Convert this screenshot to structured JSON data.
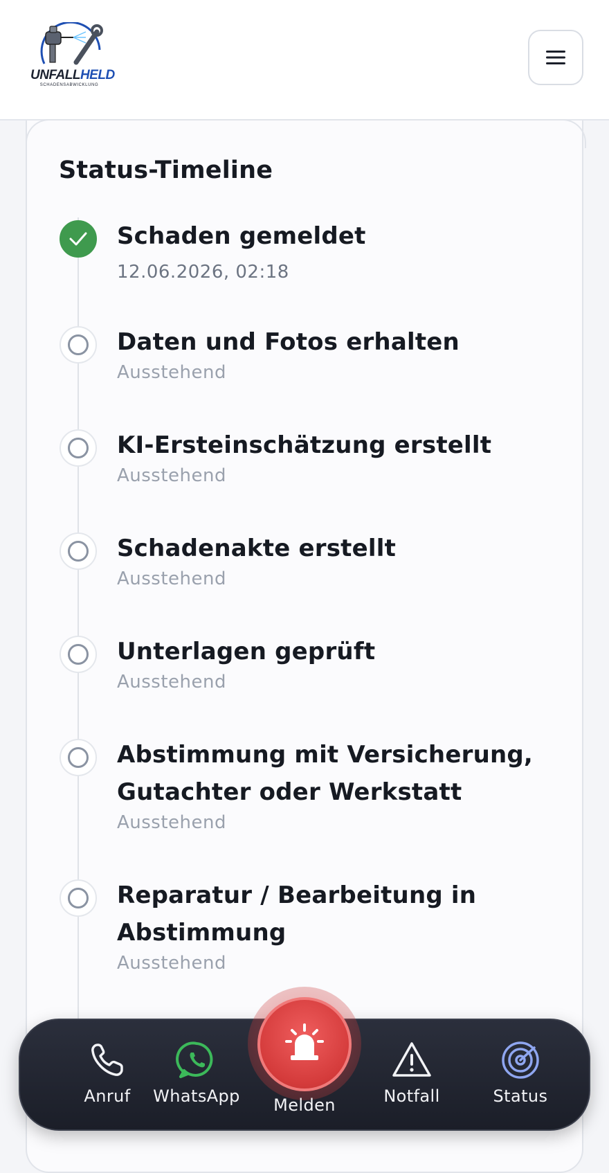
{
  "header": {
    "logo_main": "UNFALL",
    "logo_accent": "HELD",
    "logo_sub": "SCHADENSABWICKLUNG",
    "menu_icon": "hamburger-menu-icon"
  },
  "timeline": {
    "title": "Status-Timeline",
    "steps": [
      {
        "title": "Schaden gemeldet",
        "sub": "12.06.2026, 02:18",
        "state": "done"
      },
      {
        "title": "Daten und Fotos erhalten",
        "sub": "Ausstehend",
        "state": "pending"
      },
      {
        "title": "KI-Ersteinschätzung erstellt",
        "sub": "Ausstehend",
        "state": "pending"
      },
      {
        "title": "Schadenakte erstellt",
        "sub": "Ausstehend",
        "state": "pending"
      },
      {
        "title": "Unterlagen geprüft",
        "sub": "Ausstehend",
        "state": "pending"
      },
      {
        "title": "Abstimmung mit Versicherung, Gutachter oder Werkstatt",
        "sub": "Ausstehend",
        "state": "pending"
      },
      {
        "title": "Reparatur / Bearbeitung in Abstimmung",
        "sub": "Ausstehend",
        "state": "pending"
      }
    ]
  },
  "dock": {
    "anruf": "Anruf",
    "whatsapp": "WhatsApp",
    "melden": "Melden",
    "notfall": "Notfall",
    "status": "Status"
  },
  "colors": {
    "done": "#3f9a4e",
    "melden": "#d43b3b",
    "whatsapp": "#3cb95a",
    "status_icon": "#8fa6f0",
    "logo_blue": "#1e4fb3"
  }
}
